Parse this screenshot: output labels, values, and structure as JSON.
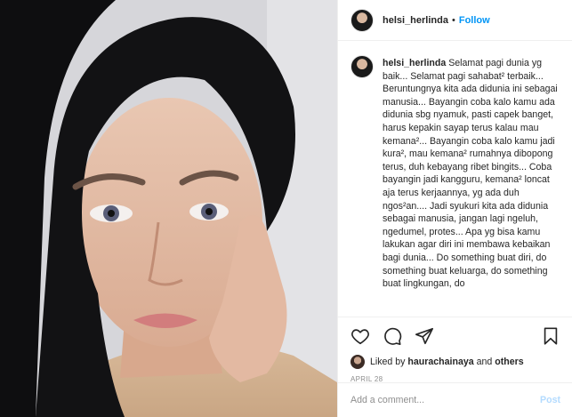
{
  "post": {
    "username": "helsi_herlinda",
    "separator": "•",
    "follow_label": "Follow",
    "caption_username": "helsi_herlinda",
    "caption_text": "Selamat pagi dunia yg baik... Selamat pagi sahabat² terbaik... Beruntungnya kita ada didunia ini sebagai manusia... Bayangin coba kalo kamu ada didunia sbg nyamuk, pasti capek banget, harus kepakin sayap terus kalau mau kemana²... Bayangin coba kalo kamu jadi kura², mau kemana² rumahnya dibopong terus, duh kebayang ribet bingits... Coba bayangin jadi kangguru, kemana² loncat aja terus kerjaannya, yg ada duh ngos²an.... Jadi syukuri kita ada didunia sebagai manusia, jangan lagi ngeluh, ngedumel, protes... Apa yg bisa kamu lakukan agar diri ini membawa kebaikan bagi dunia... Do something buat diri, do something buat keluarga, do something buat lingkungan, do",
    "likes_prefix": "Liked by ",
    "likes_user": "haurachainaya",
    "likes_suffix": " and ",
    "likes_others": "others",
    "date": "APRIL 28"
  },
  "actions": {
    "like_icon": "heart-icon",
    "comment_icon": "comment-icon",
    "share_icon": "share-icon",
    "save_icon": "bookmark-icon"
  },
  "comment": {
    "placeholder": "Add a comment...",
    "post_label": "Post"
  }
}
